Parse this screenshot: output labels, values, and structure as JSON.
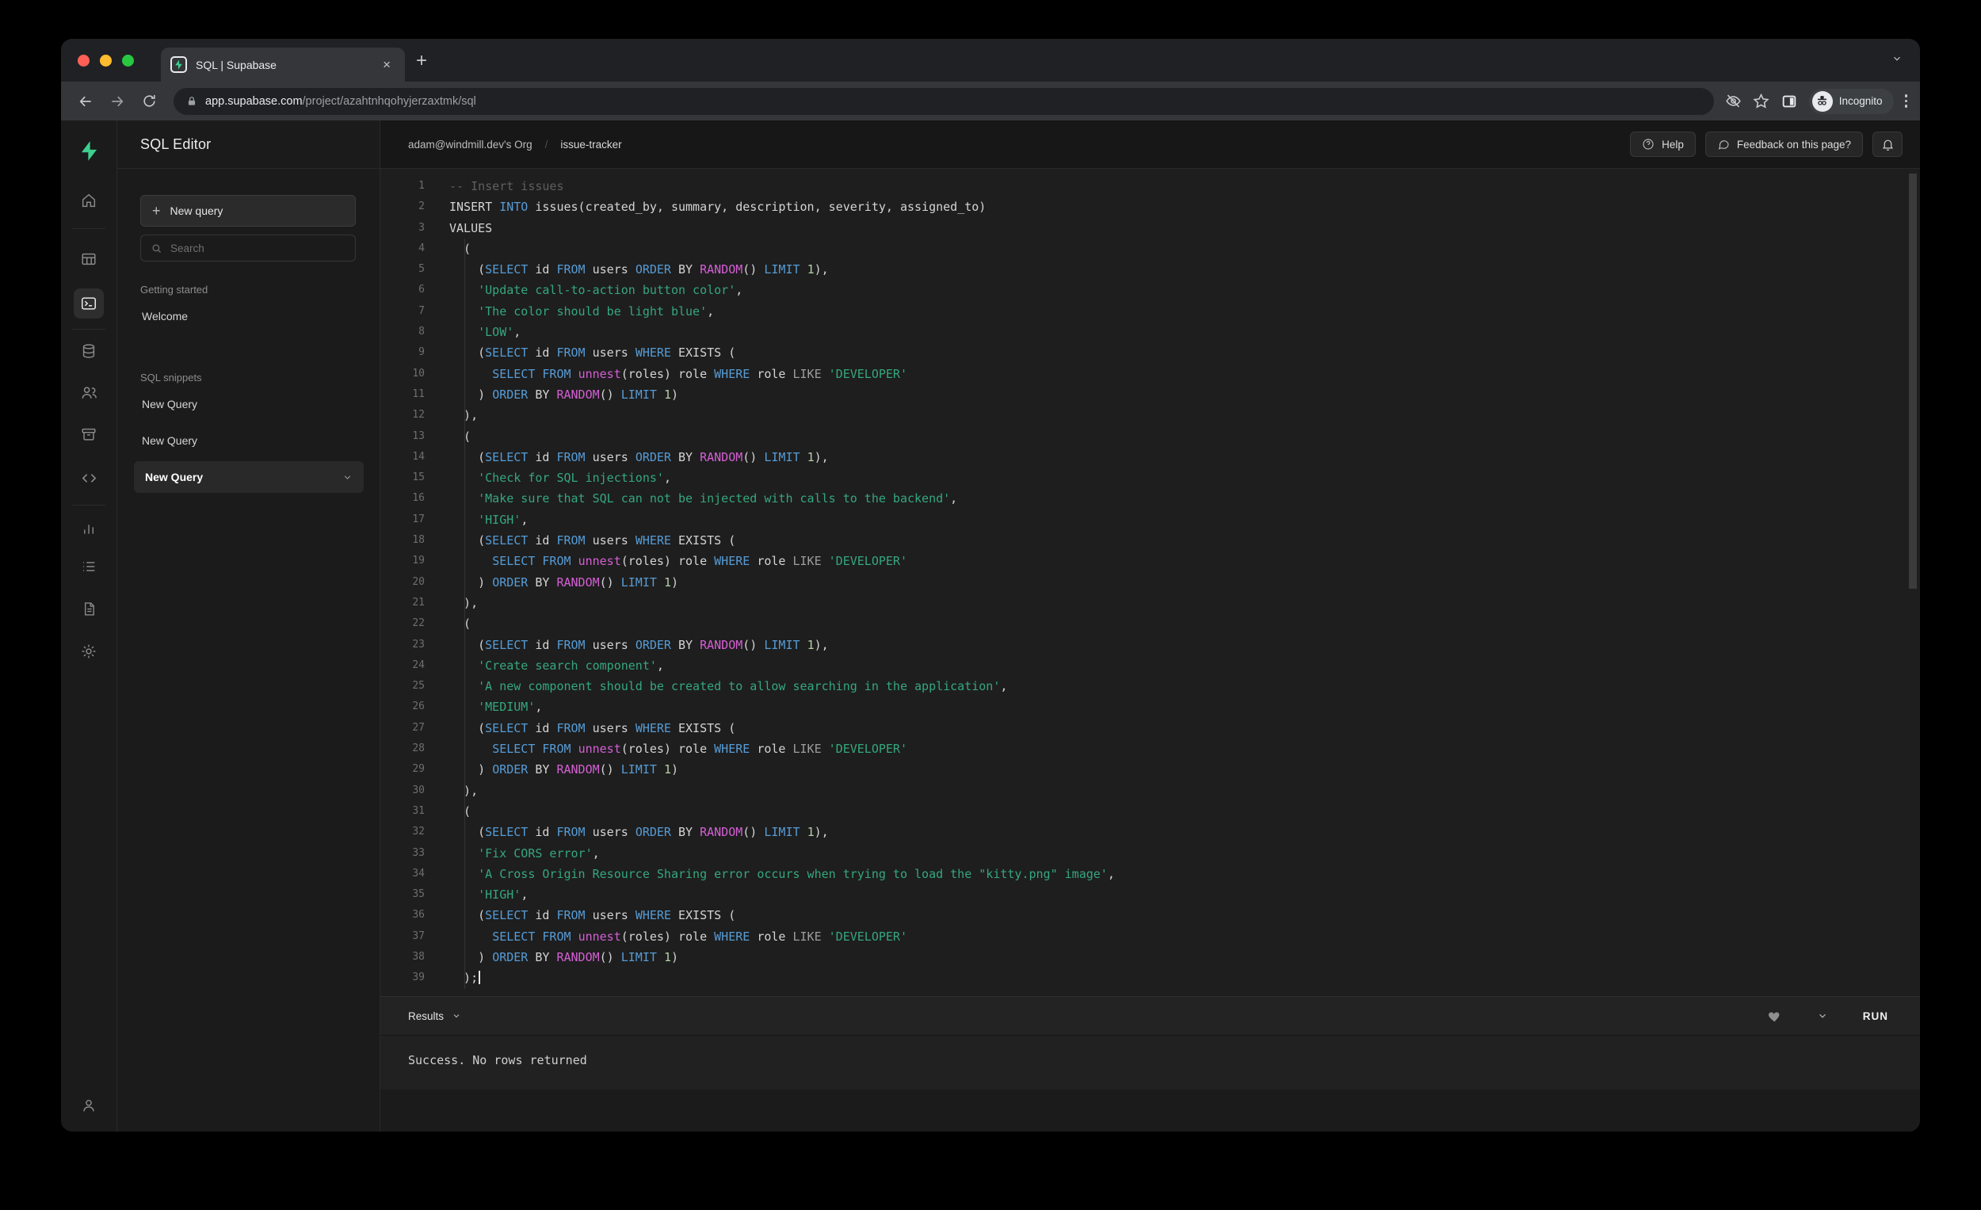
{
  "browser": {
    "tab_title": "SQL | Supabase",
    "new_tab_glyph": "+",
    "close_glyph": "×",
    "url_domain": "app.supabase.com",
    "url_path": "/project/azahtnhqohyjerzaxtmk/sql",
    "incognito_label": "Incognito"
  },
  "sidebar": {
    "title": "SQL Editor",
    "new_query_button": "New query",
    "search_placeholder": "Search",
    "getting_started_label": "Getting started",
    "welcome_item": "Welcome",
    "snippets_label": "SQL snippets",
    "snippets": [
      "New Query",
      "New Query",
      "New Query"
    ]
  },
  "header": {
    "breadcrumb_org": "adam@windmill.dev's Org",
    "breadcrumb_sep": "/",
    "breadcrumb_project": "issue-tracker",
    "help_label": "Help",
    "feedback_label": "Feedback on this page?"
  },
  "results": {
    "bar_label": "Results",
    "run_label": "RUN",
    "message": "Success. No rows returned"
  },
  "colors": {
    "accent_green": "#3ecf8e",
    "keyword_blue": "#569cd6",
    "function_magenta": "#d55fd5",
    "string_green": "#35a77e",
    "comment_gray": "#5f5f5f",
    "editor_bg": "#1e1e1e",
    "chrome_toolbar": "#35363a"
  },
  "icons": {
    "favicon": "supabase-bolt",
    "rail": [
      "home",
      "table",
      "terminal",
      "database",
      "users",
      "archive",
      "code",
      "bar-chart",
      "list",
      "file",
      "gear",
      "user"
    ],
    "toolbar": [
      "back-arrow",
      "forward-arrow",
      "reload",
      "lock",
      "eye-off",
      "star",
      "side-panel",
      "incognito-spy",
      "kebab-menu"
    ],
    "misc": [
      "search-magnifier",
      "plus",
      "chevron-down",
      "question-circle",
      "chat-bubble",
      "bell",
      "heart"
    ]
  },
  "editor": {
    "lines": [
      [
        [
          "c",
          "-- Insert issues"
        ]
      ],
      [
        [
          "w",
          "INSERT "
        ],
        [
          "k",
          "INTO"
        ],
        [
          "w",
          " issues(created_by, summary, description, severity, assigned_to)"
        ]
      ],
      [
        [
          "w",
          "VALUES"
        ]
      ],
      [
        [
          "w",
          "  ("
        ]
      ],
      [
        [
          "w",
          "    ("
        ],
        [
          "k",
          "SELECT"
        ],
        [
          "w",
          " id "
        ],
        [
          "k",
          "FROM"
        ],
        [
          "w",
          " users "
        ],
        [
          "k",
          "ORDER"
        ],
        [
          "w",
          " BY "
        ],
        [
          "f",
          "RANDOM"
        ],
        [
          "w",
          "() "
        ],
        [
          "k",
          "LIMIT"
        ],
        [
          "w",
          " "
        ],
        [
          "n",
          "1"
        ],
        [
          "w",
          "),"
        ]
      ],
      [
        [
          "w",
          "    "
        ],
        [
          "s",
          "'Update call-to-action button color'"
        ],
        [
          "w",
          ","
        ]
      ],
      [
        [
          "w",
          "    "
        ],
        [
          "s",
          "'The color should be light blue'"
        ],
        [
          "w",
          ","
        ]
      ],
      [
        [
          "w",
          "    "
        ],
        [
          "s",
          "'LOW'"
        ],
        [
          "w",
          ","
        ]
      ],
      [
        [
          "w",
          "    ("
        ],
        [
          "k",
          "SELECT"
        ],
        [
          "w",
          " id "
        ],
        [
          "k",
          "FROM"
        ],
        [
          "w",
          " users "
        ],
        [
          "k",
          "WHERE"
        ],
        [
          "w",
          " EXISTS ("
        ]
      ],
      [
        [
          "w",
          "      "
        ],
        [
          "k",
          "SELECT"
        ],
        [
          "w",
          " "
        ],
        [
          "k",
          "FROM"
        ],
        [
          "w",
          " "
        ],
        [
          "f",
          "unnest"
        ],
        [
          "w",
          "(roles) role "
        ],
        [
          "k",
          "WHERE"
        ],
        [
          "w",
          " role "
        ],
        [
          "l",
          "LIKE"
        ],
        [
          "w",
          " "
        ],
        [
          "s",
          "'DEVELOPER'"
        ]
      ],
      [
        [
          "w",
          "    ) "
        ],
        [
          "k",
          "ORDER"
        ],
        [
          "w",
          " BY "
        ],
        [
          "f",
          "RANDOM"
        ],
        [
          "w",
          "() "
        ],
        [
          "k",
          "LIMIT"
        ],
        [
          "w",
          " "
        ],
        [
          "n",
          "1"
        ],
        [
          "w",
          ")"
        ]
      ],
      [
        [
          "w",
          "  ),"
        ]
      ],
      [
        [
          "w",
          "  ("
        ]
      ],
      [
        [
          "w",
          "    ("
        ],
        [
          "k",
          "SELECT"
        ],
        [
          "w",
          " id "
        ],
        [
          "k",
          "FROM"
        ],
        [
          "w",
          " users "
        ],
        [
          "k",
          "ORDER"
        ],
        [
          "w",
          " BY "
        ],
        [
          "f",
          "RANDOM"
        ],
        [
          "w",
          "() "
        ],
        [
          "k",
          "LIMIT"
        ],
        [
          "w",
          " "
        ],
        [
          "n",
          "1"
        ],
        [
          "w",
          "),"
        ]
      ],
      [
        [
          "w",
          "    "
        ],
        [
          "s",
          "'Check for SQL injections'"
        ],
        [
          "w",
          ","
        ]
      ],
      [
        [
          "w",
          "    "
        ],
        [
          "s",
          "'Make sure that SQL can not be injected with calls to the backend'"
        ],
        [
          "w",
          ","
        ]
      ],
      [
        [
          "w",
          "    "
        ],
        [
          "s",
          "'HIGH'"
        ],
        [
          "w",
          ","
        ]
      ],
      [
        [
          "w",
          "    ("
        ],
        [
          "k",
          "SELECT"
        ],
        [
          "w",
          " id "
        ],
        [
          "k",
          "FROM"
        ],
        [
          "w",
          " users "
        ],
        [
          "k",
          "WHERE"
        ],
        [
          "w",
          " EXISTS ("
        ]
      ],
      [
        [
          "w",
          "      "
        ],
        [
          "k",
          "SELECT"
        ],
        [
          "w",
          " "
        ],
        [
          "k",
          "FROM"
        ],
        [
          "w",
          " "
        ],
        [
          "f",
          "unnest"
        ],
        [
          "w",
          "(roles) role "
        ],
        [
          "k",
          "WHERE"
        ],
        [
          "w",
          " role "
        ],
        [
          "l",
          "LIKE"
        ],
        [
          "w",
          " "
        ],
        [
          "s",
          "'DEVELOPER'"
        ]
      ],
      [
        [
          "w",
          "    ) "
        ],
        [
          "k",
          "ORDER"
        ],
        [
          "w",
          " BY "
        ],
        [
          "f",
          "RANDOM"
        ],
        [
          "w",
          "() "
        ],
        [
          "k",
          "LIMIT"
        ],
        [
          "w",
          " "
        ],
        [
          "n",
          "1"
        ],
        [
          "w",
          ")"
        ]
      ],
      [
        [
          "w",
          "  ),"
        ]
      ],
      [
        [
          "w",
          "  ("
        ]
      ],
      [
        [
          "w",
          "    ("
        ],
        [
          "k",
          "SELECT"
        ],
        [
          "w",
          " id "
        ],
        [
          "k",
          "FROM"
        ],
        [
          "w",
          " users "
        ],
        [
          "k",
          "ORDER"
        ],
        [
          "w",
          " BY "
        ],
        [
          "f",
          "RANDOM"
        ],
        [
          "w",
          "() "
        ],
        [
          "k",
          "LIMIT"
        ],
        [
          "w",
          " "
        ],
        [
          "n",
          "1"
        ],
        [
          "w",
          "),"
        ]
      ],
      [
        [
          "w",
          "    "
        ],
        [
          "s",
          "'Create search component'"
        ],
        [
          "w",
          ","
        ]
      ],
      [
        [
          "w",
          "    "
        ],
        [
          "s",
          "'A new component should be created to allow searching in the application'"
        ],
        [
          "w",
          ","
        ]
      ],
      [
        [
          "w",
          "    "
        ],
        [
          "s",
          "'MEDIUM'"
        ],
        [
          "w",
          ","
        ]
      ],
      [
        [
          "w",
          "    ("
        ],
        [
          "k",
          "SELECT"
        ],
        [
          "w",
          " id "
        ],
        [
          "k",
          "FROM"
        ],
        [
          "w",
          " users "
        ],
        [
          "k",
          "WHERE"
        ],
        [
          "w",
          " EXISTS ("
        ]
      ],
      [
        [
          "w",
          "      "
        ],
        [
          "k",
          "SELECT"
        ],
        [
          "w",
          " "
        ],
        [
          "k",
          "FROM"
        ],
        [
          "w",
          " "
        ],
        [
          "f",
          "unnest"
        ],
        [
          "w",
          "(roles) role "
        ],
        [
          "k",
          "WHERE"
        ],
        [
          "w",
          " role "
        ],
        [
          "l",
          "LIKE"
        ],
        [
          "w",
          " "
        ],
        [
          "s",
          "'DEVELOPER'"
        ]
      ],
      [
        [
          "w",
          "    ) "
        ],
        [
          "k",
          "ORDER"
        ],
        [
          "w",
          " BY "
        ],
        [
          "f",
          "RANDOM"
        ],
        [
          "w",
          "() "
        ],
        [
          "k",
          "LIMIT"
        ],
        [
          "w",
          " "
        ],
        [
          "n",
          "1"
        ],
        [
          "w",
          ")"
        ]
      ],
      [
        [
          "w",
          "  ),"
        ]
      ],
      [
        [
          "w",
          "  ("
        ]
      ],
      [
        [
          "w",
          "    ("
        ],
        [
          "k",
          "SELECT"
        ],
        [
          "w",
          " id "
        ],
        [
          "k",
          "FROM"
        ],
        [
          "w",
          " users "
        ],
        [
          "k",
          "ORDER"
        ],
        [
          "w",
          " BY "
        ],
        [
          "f",
          "RANDOM"
        ],
        [
          "w",
          "() "
        ],
        [
          "k",
          "LIMIT"
        ],
        [
          "w",
          " "
        ],
        [
          "n",
          "1"
        ],
        [
          "w",
          "),"
        ]
      ],
      [
        [
          "w",
          "    "
        ],
        [
          "s",
          "'Fix CORS error'"
        ],
        [
          "w",
          ","
        ]
      ],
      [
        [
          "w",
          "    "
        ],
        [
          "s",
          "'A Cross Origin Resource Sharing error occurs when trying to load the \"kitty.png\" image'"
        ],
        [
          "w",
          ","
        ]
      ],
      [
        [
          "w",
          "    "
        ],
        [
          "s",
          "'HIGH'"
        ],
        [
          "w",
          ","
        ]
      ],
      [
        [
          "w",
          "    ("
        ],
        [
          "k",
          "SELECT"
        ],
        [
          "w",
          " id "
        ],
        [
          "k",
          "FROM"
        ],
        [
          "w",
          " users "
        ],
        [
          "k",
          "WHERE"
        ],
        [
          "w",
          " EXISTS ("
        ]
      ],
      [
        [
          "w",
          "      "
        ],
        [
          "k",
          "SELECT"
        ],
        [
          "w",
          " "
        ],
        [
          "k",
          "FROM"
        ],
        [
          "w",
          " "
        ],
        [
          "f",
          "unnest"
        ],
        [
          "w",
          "(roles) role "
        ],
        [
          "k",
          "WHERE"
        ],
        [
          "w",
          " role "
        ],
        [
          "l",
          "LIKE"
        ],
        [
          "w",
          " "
        ],
        [
          "s",
          "'DEVELOPER'"
        ]
      ],
      [
        [
          "w",
          "    ) "
        ],
        [
          "k",
          "ORDER"
        ],
        [
          "w",
          " BY "
        ],
        [
          "f",
          "RANDOM"
        ],
        [
          "w",
          "() "
        ],
        [
          "k",
          "LIMIT"
        ],
        [
          "w",
          " "
        ],
        [
          "n",
          "1"
        ],
        [
          "w",
          ")"
        ]
      ],
      [
        [
          "w",
          "  );"
        ]
      ]
    ]
  }
}
